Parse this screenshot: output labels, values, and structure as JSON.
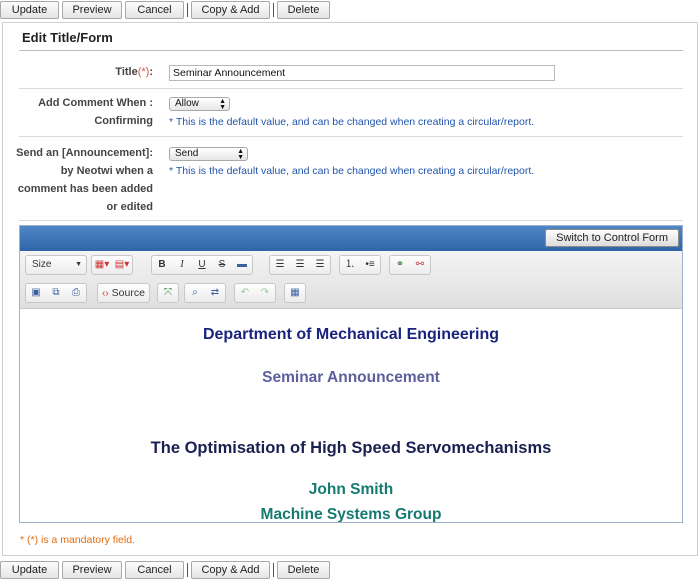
{
  "actions": [
    "Update",
    "Preview",
    "Cancel",
    "Copy & Add",
    "Delete"
  ],
  "panel_title": "Edit Title/Form",
  "form": {
    "title": {
      "label": "Title",
      "req_mark": "(*)",
      "colon": ":",
      "value": "Seminar Announcement"
    },
    "comment": {
      "label_line1": "Add Comment When :",
      "label_line2": "Confirming",
      "select_value": "Allow",
      "note": "* This is the default value, and can be changed when creating a circular/report."
    },
    "announce": {
      "label_line1": "Send an [Announcement]:",
      "label_line2": "by Neotwi when a",
      "label_line3": "comment has been added",
      "label_line4": "or edited",
      "select_value": "Send",
      "note": "* This is the default value, and can be changed when creating a circular/report."
    }
  },
  "editor": {
    "switch_label": "Switch to Control Form",
    "size_label": "Size",
    "source_label": "Source",
    "content": {
      "line1": "Department of Mechanical Engineering",
      "line2": "Seminar Announcement",
      "line3": "The Optimisation of High Speed Servomechanisms",
      "line4": "John Smith",
      "line5": "Machine Systems Group"
    }
  },
  "mandatory_note": "* (*) is a mandatory field.",
  "colors": {
    "header_blue": "#3a72b8",
    "note_blue": "#2255aa",
    "required_red": "#d9534f",
    "mandatory_orange": "#e46a10"
  }
}
